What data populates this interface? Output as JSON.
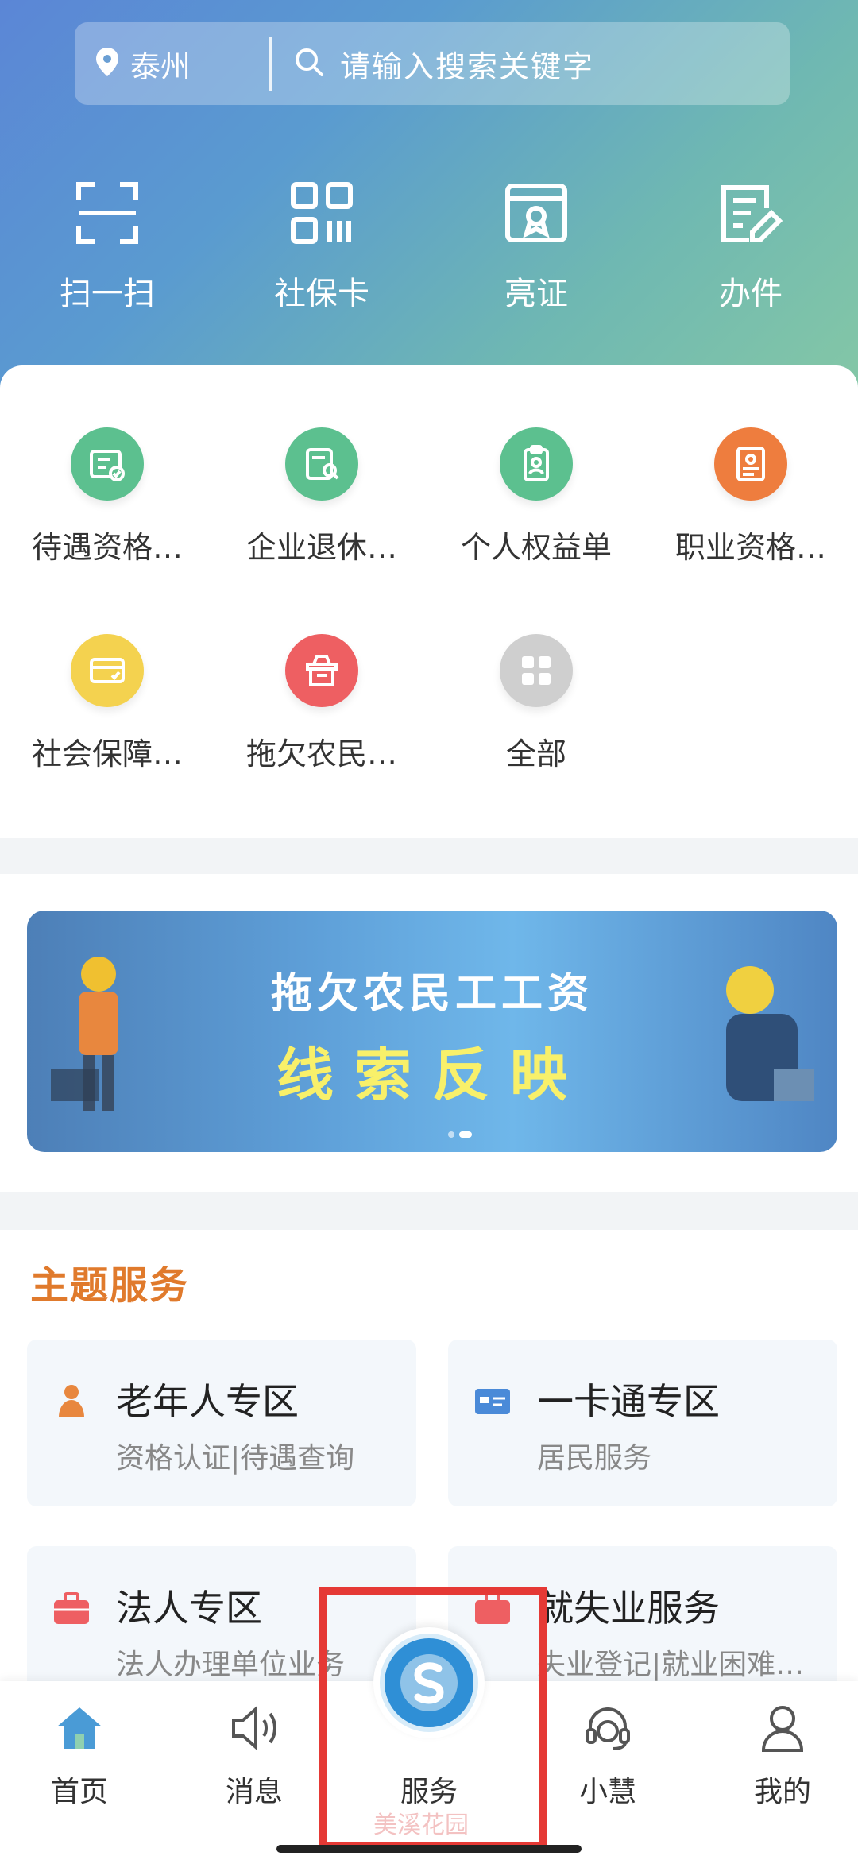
{
  "search": {
    "location": "泰州",
    "placeholder": "请输入搜索关键字"
  },
  "quick_actions": [
    {
      "label": "扫一扫",
      "icon": "scan-icon"
    },
    {
      "label": "社保卡",
      "icon": "qr-code-icon"
    },
    {
      "label": "亮证",
      "icon": "certificate-icon"
    },
    {
      "label": "办件",
      "icon": "edit-document-icon"
    }
  ],
  "services": [
    {
      "label": "待遇资格…",
      "icon": "id-card-check-icon",
      "color": "#5cc08f"
    },
    {
      "label": "企业退休…",
      "icon": "document-search-icon",
      "color": "#5cc08f"
    },
    {
      "label": "个人权益单",
      "icon": "clipboard-person-icon",
      "color": "#5cc08f"
    },
    {
      "label": "职业资格…",
      "icon": "credential-icon",
      "color": "#ee7d3e"
    },
    {
      "label": "社会保障…",
      "icon": "card-check-icon",
      "color": "#f4d24f"
    },
    {
      "label": "拖欠农民…",
      "icon": "box-icon",
      "color": "#ee5f62"
    },
    {
      "label": "全部",
      "icon": "grid-icon",
      "color": "#cfcfcf"
    }
  ],
  "banner": {
    "line1": "拖欠农民工工资",
    "line2": "线索反映"
  },
  "theme": {
    "title": "主题服务",
    "tiles": [
      {
        "name": "老年人专区",
        "sub": "资格认证|待遇查询",
        "icon": "elderly-icon",
        "color": "#e8873e"
      },
      {
        "name": "一卡通专区",
        "sub": "居民服务",
        "icon": "card-icon",
        "color": "#4a8ad8"
      },
      {
        "name": "法人专区",
        "sub": "法人办理单位业务",
        "icon": "briefcase-icon",
        "color": "#ee5f62"
      },
      {
        "name": "就失业服务",
        "sub": "失业登记|就业困难…",
        "icon": "job-icon",
        "color": "#ee5f62"
      }
    ]
  },
  "nav": {
    "items": [
      {
        "label": "首页",
        "icon": "home-icon"
      },
      {
        "label": "消息",
        "icon": "speaker-icon"
      },
      {
        "label": "服务",
        "icon": "service-logo-icon"
      },
      {
        "label": "小慧",
        "icon": "headset-icon"
      },
      {
        "label": "我的",
        "icon": "user-icon"
      }
    ]
  },
  "watermark": "美溪花园"
}
